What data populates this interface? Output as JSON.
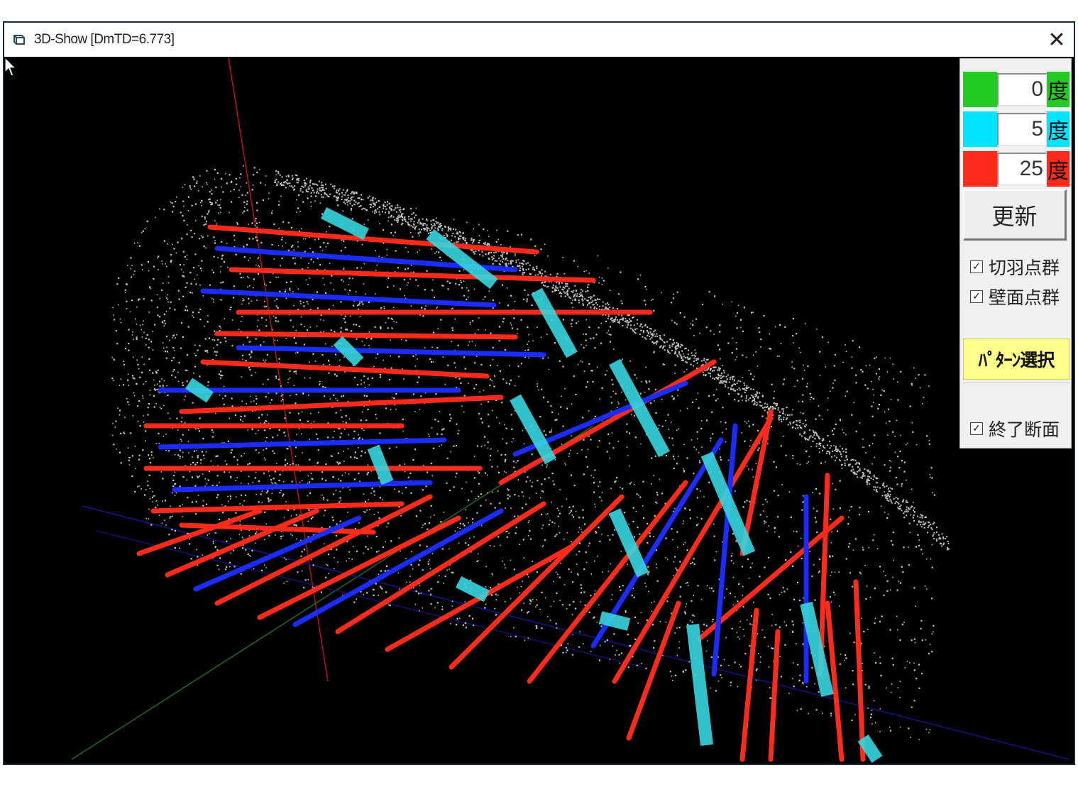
{
  "window": {
    "title": "3D-Show [DmTD=6.773]",
    "close_label": "✕"
  },
  "panel": {
    "angles": [
      {
        "value": "0",
        "unit": "度",
        "color": "#22cc22"
      },
      {
        "value": "5",
        "unit": "度",
        "color": "#00e5ff"
      },
      {
        "value": "25",
        "unit": "度",
        "color": "#ff2a1a"
      }
    ],
    "update_label": "更新",
    "checks": [
      {
        "label": "切羽点群",
        "checked": true
      },
      {
        "label": "壁面点群",
        "checked": true
      }
    ],
    "pattern_label": "ﾊﾟﾀｰﾝ選択",
    "end_check": {
      "label": "終了断面",
      "checked": true
    }
  },
  "colors": {
    "viewport_bg": "#000000",
    "points": "#e8e8e8",
    "bolt_red": "#ff2a1a",
    "bolt_blue": "#1a2cff",
    "bolt_cyan": "#37d6e0",
    "axis_red": "#c01010",
    "axis_green": "#1f6b1f",
    "axis_blue": "#14148a"
  }
}
